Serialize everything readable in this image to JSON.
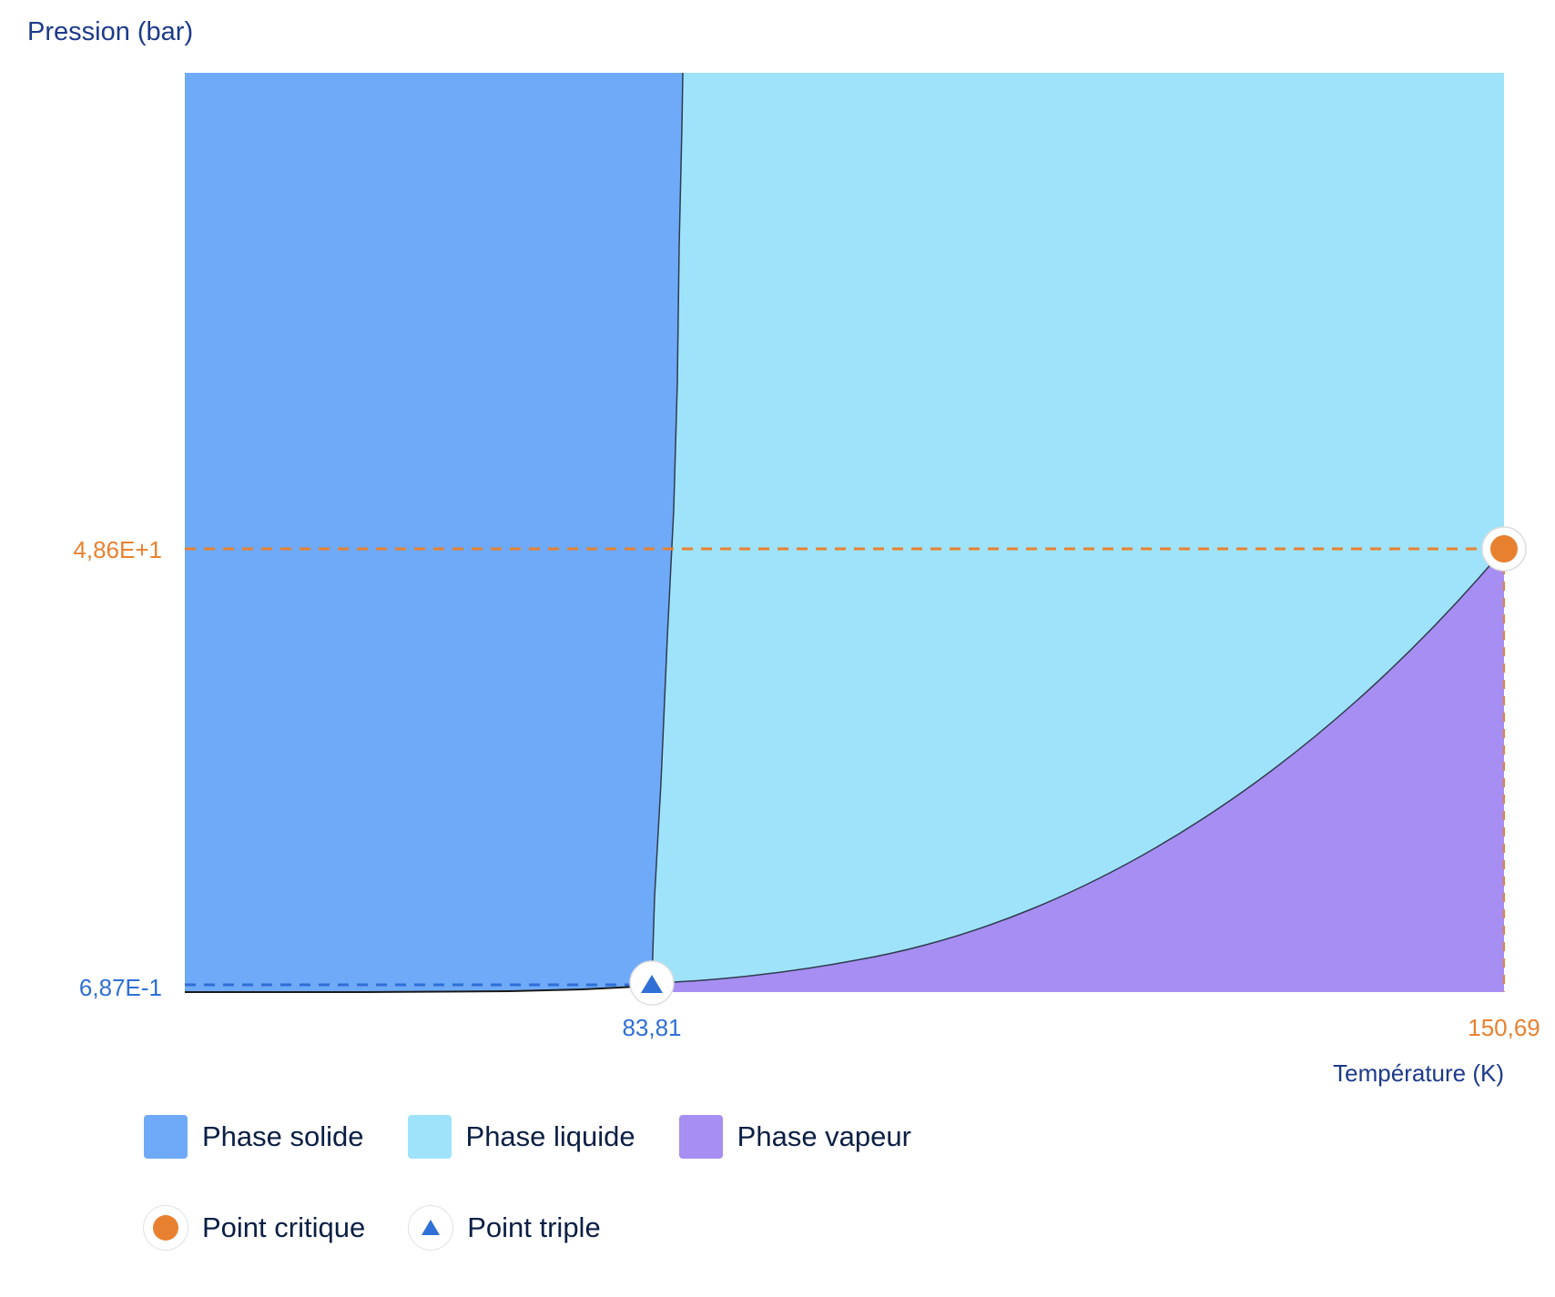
{
  "chart_data": {
    "type": "area",
    "y_title": "Pression (bar)",
    "x_title": "Température (K)",
    "x_ticks": [
      "83,81",
      "150,69"
    ],
    "y_ticks": [
      "4,86E+1",
      "6,87E-1"
    ],
    "triple_point": {
      "T": 83.81,
      "P": 0.687
    },
    "critical_point": {
      "T": 150.69,
      "P": 48.6
    },
    "phases": [
      {
        "name": "Phase solide",
        "color": "#6eaaf8"
      },
      {
        "name": "Phase liquide",
        "color": "#9fe3fa"
      },
      {
        "name": "Phase vapeur",
        "color": "#a68ef2"
      }
    ],
    "points": [
      {
        "name": "Point critique",
        "color": "#e8812f"
      },
      {
        "name": "Point triple",
        "color": "#2f6fd6"
      }
    ],
    "colors": {
      "critical": "#e8812f",
      "triple": "#2f6fd6",
      "axis_title": "#1d3a8a"
    }
  }
}
